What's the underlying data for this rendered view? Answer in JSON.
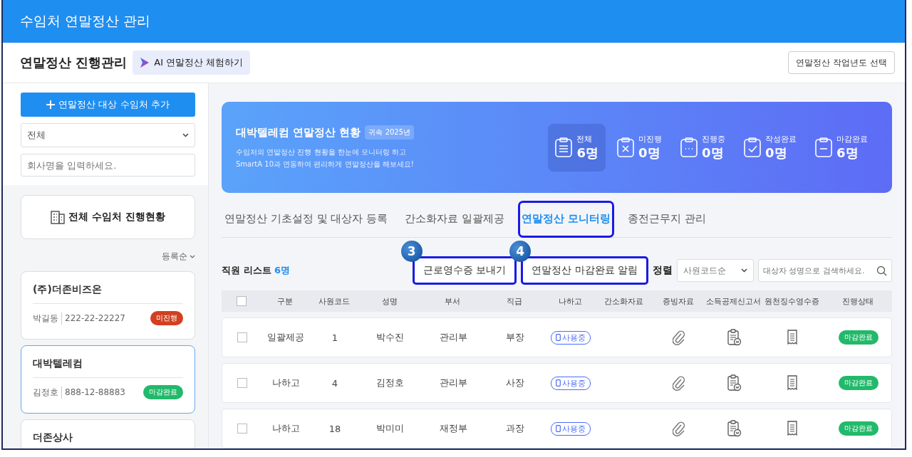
{
  "app_title": "수임처 연말정산 관리",
  "header": {
    "title": "연말정산 진행관리",
    "ai_button": "AI 연말정산 체험하기",
    "year_button": "연말정산 작업년도 선택"
  },
  "sidebar": {
    "add_button": "연말정산 대상 수임처 추가",
    "filter_select": "전체",
    "search": {
      "placeholder": "회사명을 입력하세요."
    },
    "overview_button": "전체 수임처 진행현황",
    "sort": "등록순",
    "clients": [
      {
        "name": "(주)더존비즈온",
        "manager": "박길동",
        "biz_no": "222-22-22227",
        "status": "미진행",
        "color": "#d2401f",
        "selected": false
      },
      {
        "name": "대박텔레컴",
        "manager": "김정호",
        "biz_no": "888-12-88883",
        "status": "마감완료",
        "color": "#22b96b",
        "selected": true
      },
      {
        "name": "더존상사",
        "selected": false
      }
    ]
  },
  "banner": {
    "title": "대박텔레컴 연말정산 현황",
    "year_tag": "귀속 2025년",
    "description": [
      "수임처의 연말정산 진행 현황을 한눈에 모니터링 하고",
      "SmartA 10과 연동하여 편리하게 연말정산을 해보세요!"
    ],
    "stats": [
      {
        "kind": "total",
        "label": "전체",
        "value": "6명",
        "selected": true
      },
      {
        "kind": "not_started",
        "label": "미진행",
        "value": "0명",
        "selected": false
      },
      {
        "kind": "in_progress",
        "label": "진행중",
        "value": "0명",
        "selected": false
      },
      {
        "kind": "written",
        "label": "작성완료",
        "value": "0명",
        "selected": false
      },
      {
        "kind": "closed",
        "label": "마감완료",
        "value": "6명",
        "selected": false
      }
    ]
  },
  "tabs": [
    {
      "label": "연말정산 기초설정 및 대상자 등록",
      "selected": false,
      "outlined": false
    },
    {
      "label": "간소화자료 일괄제공",
      "selected": false,
      "outlined": false
    },
    {
      "label": "연말정산 모니터링",
      "selected": true,
      "outlined": true
    },
    {
      "label": "종전근무지 관리",
      "selected": false,
      "outlined": false
    }
  ],
  "list": {
    "title": "직원 리스트",
    "count": "6명",
    "actions": [
      {
        "label": "근로영수증 보내기",
        "callout": "3"
      },
      {
        "label": "연말정산 마감완료 알림",
        "callout": "4"
      }
    ],
    "sort_label": "정렬",
    "sort_select": "사원코드순",
    "search": {
      "placeholder": "대상자 성명으로 검색하세요."
    }
  },
  "table": {
    "all_checked": false,
    "columns": [
      "구분",
      "사원코드",
      "성명",
      "부서",
      "직급",
      "나하고",
      "간소화자료",
      "증빙자료",
      "소득공제신고서",
      "원천징수영수증",
      "진행상태"
    ],
    "rows": [
      {
        "checked": false,
        "type": "일괄제공",
        "code": "1",
        "name": "박수진",
        "dept": "관리부",
        "position": "부장",
        "nahago": "사용중",
        "status": "마감완료",
        "color": "#22b96b"
      },
      {
        "checked": false,
        "type": "나하고",
        "code": "4",
        "name": "김정호",
        "dept": "관리부",
        "position": "사장",
        "nahago": "사용중",
        "status": "마감완료",
        "color": "#22b96b"
      },
      {
        "checked": false,
        "type": "나하고",
        "code": "18",
        "name": "박미미",
        "dept": "재정부",
        "position": "과장",
        "nahago": "사용중",
        "status": "마감완료",
        "color": "#22b96b"
      }
    ]
  }
}
